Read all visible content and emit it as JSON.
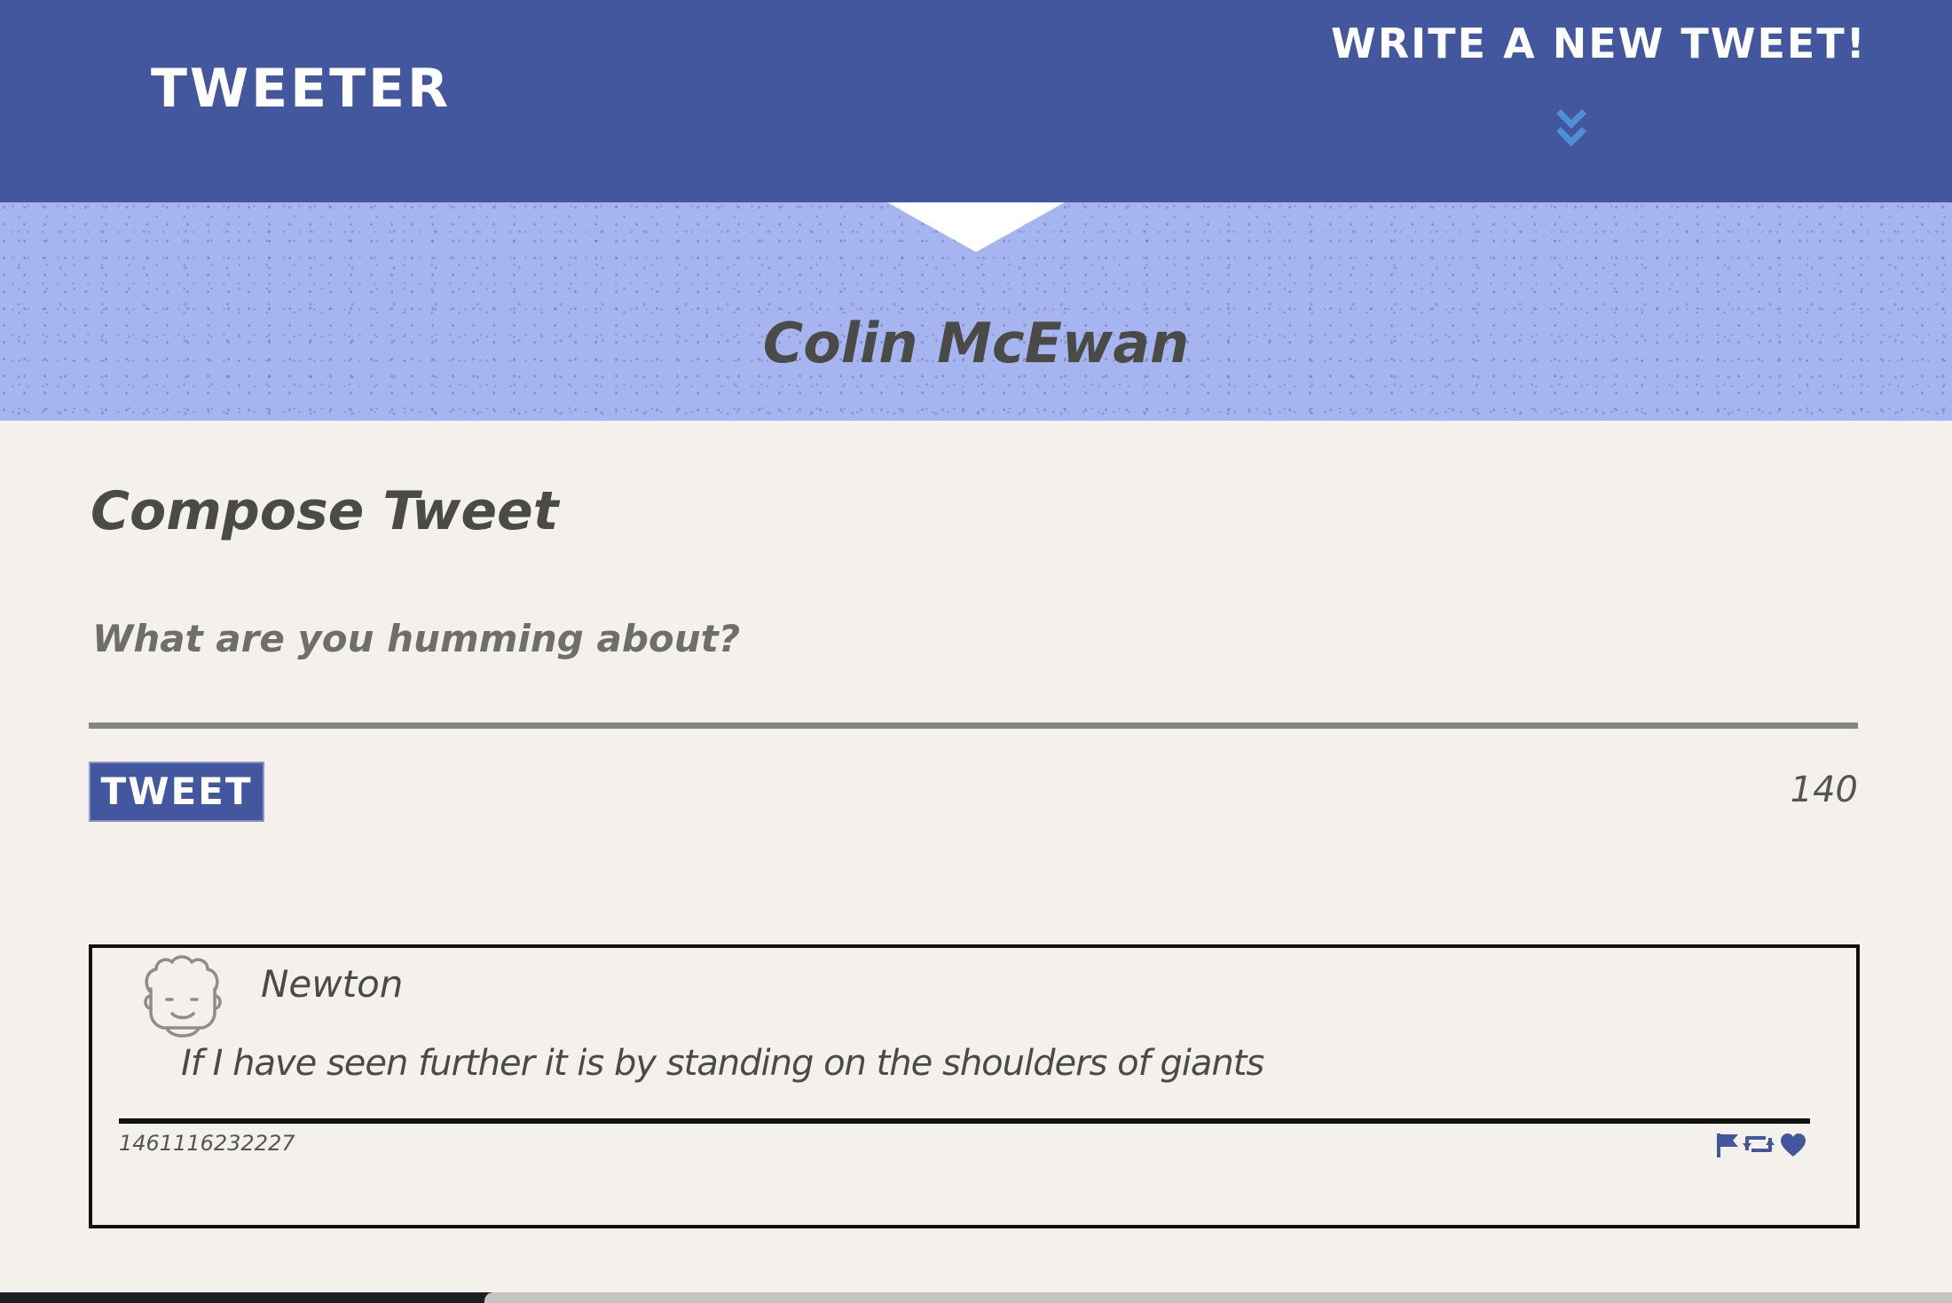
{
  "navbar": {
    "brand": "TWEETER",
    "compose_toggle_label": "WRITE A NEW TWEET!",
    "compose_toggle_icon": "double-chevron-down-icon"
  },
  "profile": {
    "name": "Colin McEwan"
  },
  "compose": {
    "title": "Compose Tweet",
    "placeholder": "What are you humming about?",
    "value": "",
    "submit_label": "TWEET",
    "char_counter": "140"
  },
  "tweets": [
    {
      "avatar_icon": "avatar-face-icon",
      "author": "Newton",
      "text": "If I have seen further it is by standing on the shoulders of giants",
      "timestamp": "1461116232227",
      "actions": [
        "flag-icon",
        "retweet-icon",
        "heart-icon"
      ]
    }
  ],
  "colors": {
    "nav_background": "#42579e",
    "banner_background": "#a6b4ef",
    "page_background": "#f4f1ec",
    "text_dark": "#4a4a47",
    "accent_chevron": "#4e90d6"
  }
}
